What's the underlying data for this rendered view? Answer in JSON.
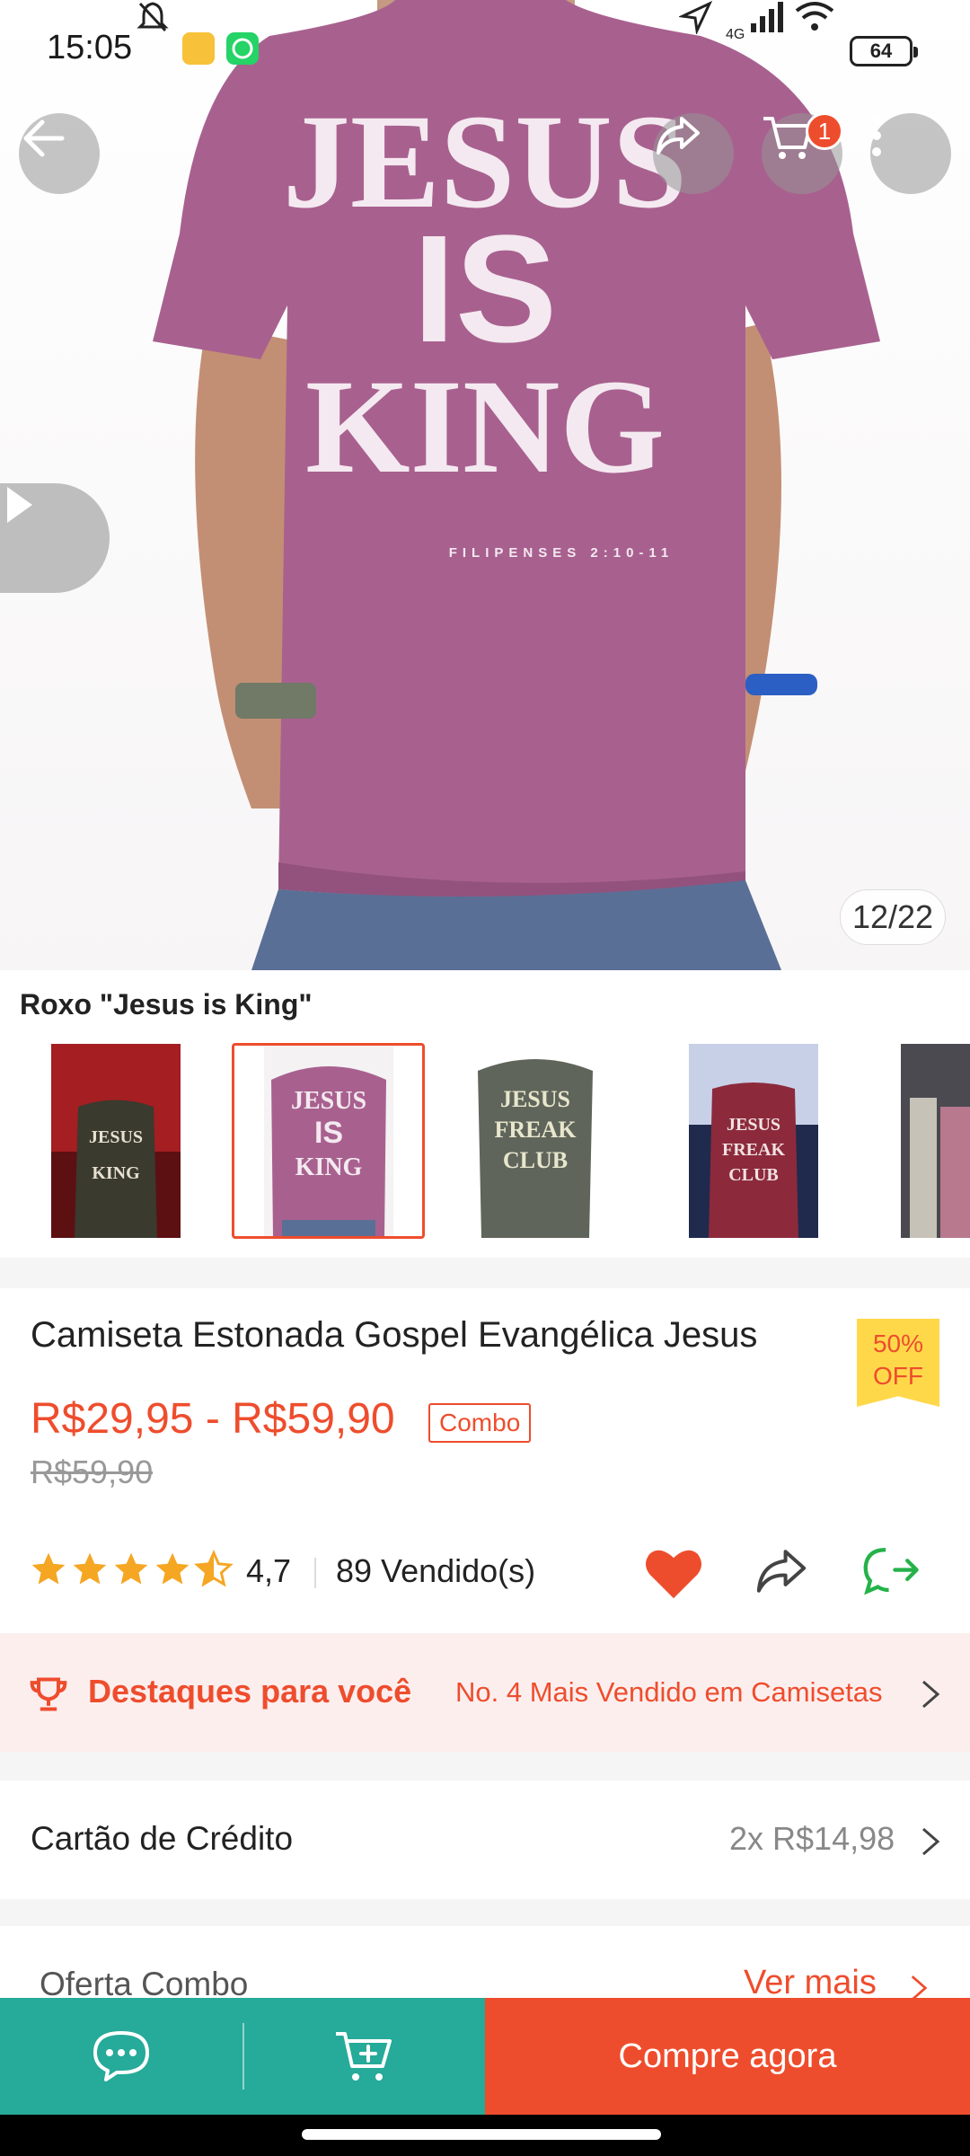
{
  "status_bar": {
    "time": "15:05",
    "network": "4G",
    "battery": "64"
  },
  "cart": {
    "badge_count": "1"
  },
  "gallery": {
    "counter": "12/22",
    "variant_label": "Roxo \"Jesus is King\"",
    "selected_index": 1
  },
  "hero_print": {
    "line1": "JESUS",
    "line2": "IS",
    "line3": "KING",
    "ref": "FILIPENSES 2:10-11"
  },
  "thumbnails": [
    {
      "id": "green-jesus-king",
      "print": "JESUS IS KING"
    },
    {
      "id": "purple-jesus-king",
      "print": "JESUS IS KING"
    },
    {
      "id": "gray-jesus-freak-club",
      "print": "JESUS FREAK CLUB"
    },
    {
      "id": "wine-jesus-freak-club",
      "print": "JESUS FREAK CLUB"
    },
    {
      "id": "partial-fifth",
      "print": ""
    }
  ],
  "product": {
    "title": "Camiseta Estonada Gospel Evangélica Jesus",
    "discount_line1": "50%",
    "discount_line2": "OFF",
    "price_range": "R$29,95 - R$59,90",
    "combo_tag": "Combo",
    "original_price": "R$59,90",
    "rating": "4,7",
    "rating_value": 4.7,
    "sold": "89 Vendido(s)"
  },
  "highlight": {
    "title": "Destaques para você",
    "text": "No. 4 Mais Vendido em Camisetas"
  },
  "credit": {
    "label": "Cartão de Crédito",
    "value": "2x R$14,98"
  },
  "combo_offer": {
    "label": "Oferta Combo",
    "link": "Ver mais"
  },
  "bottom_bar": {
    "buy_label": "Compre agora"
  },
  "colors": {
    "accent": "#ee4d2d",
    "teal": "#26aa99",
    "shirt": "#a8618f",
    "star": "#f5a623"
  }
}
